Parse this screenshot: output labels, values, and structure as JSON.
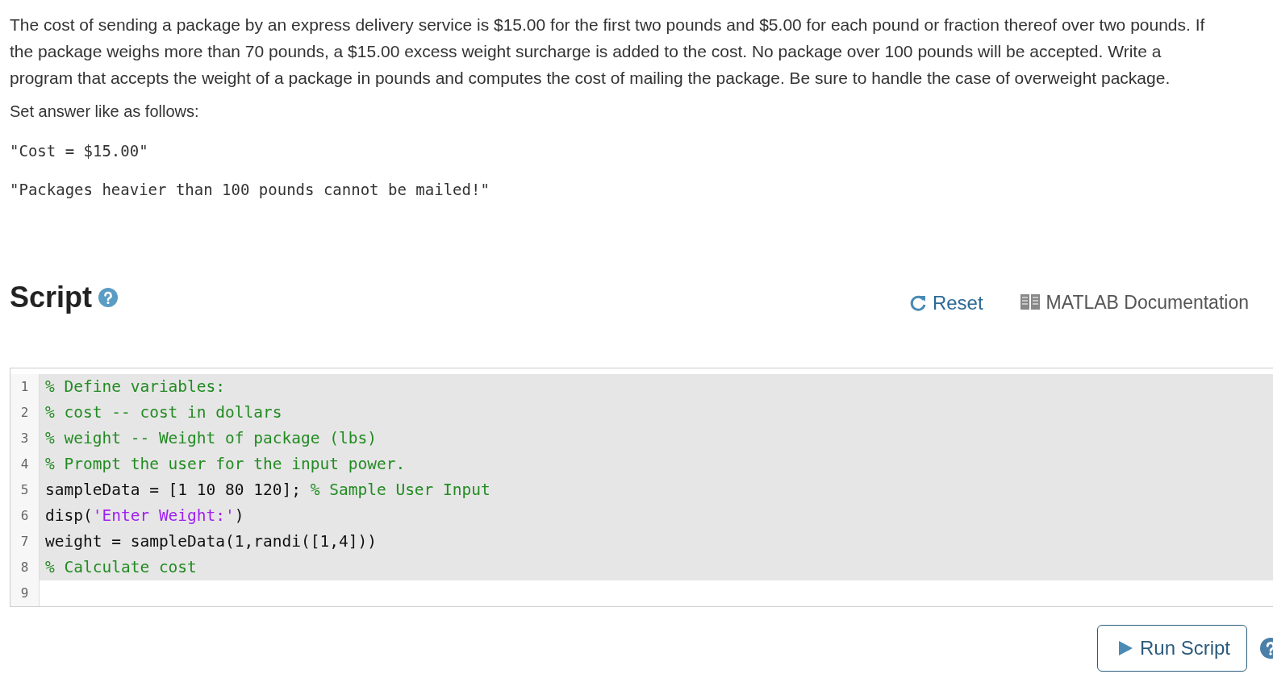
{
  "description": "The cost of sending a package by an express delivery service is $15.00 for the first two pounds and $5.00 for each pound or fraction thereof over two pounds. If the package weighs more than 70 pounds, a $15.00 excess weight surcharge is added to the cost. No package over 100 pounds will be accepted. Write a program that accepts the weight of a package in pounds and computes the cost of mailing the package. Be sure to handle the case of overweight package.",
  "instruction": "Set answer like as follows:",
  "examples": [
    "\"Cost = $15.00\"",
    "\"Packages heavier than 100 pounds cannot be mailed!\""
  ],
  "script": {
    "title": "Script",
    "reset": "Reset",
    "documentation": "MATLAB Documentation"
  },
  "editor": {
    "lines": [
      {
        "number": "1",
        "locked": true,
        "tokens": [
          {
            "kind": "comment",
            "text": "% Define variables:"
          }
        ]
      },
      {
        "number": "2",
        "locked": true,
        "tokens": [
          {
            "kind": "comment",
            "text": "% cost -- cost in dollars"
          }
        ]
      },
      {
        "number": "3",
        "locked": true,
        "tokens": [
          {
            "kind": "comment",
            "text": "% weight -- Weight of package (lbs)"
          }
        ]
      },
      {
        "number": "4",
        "locked": true,
        "tokens": [
          {
            "kind": "comment",
            "text": "% Prompt the user for the input power."
          }
        ]
      },
      {
        "number": "5",
        "locked": true,
        "tokens": [
          {
            "kind": "code",
            "text": "sampleData = [1 10 80 120]; "
          },
          {
            "kind": "comment",
            "text": "% Sample User Input"
          }
        ]
      },
      {
        "number": "6",
        "locked": true,
        "tokens": [
          {
            "kind": "code",
            "text": "disp("
          },
          {
            "kind": "string",
            "text": "'Enter Weight:'"
          },
          {
            "kind": "code",
            "text": ")"
          }
        ]
      },
      {
        "number": "7",
        "locked": true,
        "tokens": [
          {
            "kind": "code",
            "text": "weight = sampleData(1,randi([1,4]))"
          }
        ]
      },
      {
        "number": "8",
        "locked": true,
        "tokens": [
          {
            "kind": "comment",
            "text": "% Calculate cost"
          }
        ]
      },
      {
        "number": "9",
        "locked": false
      }
    ]
  },
  "run_button": "Run Script"
}
